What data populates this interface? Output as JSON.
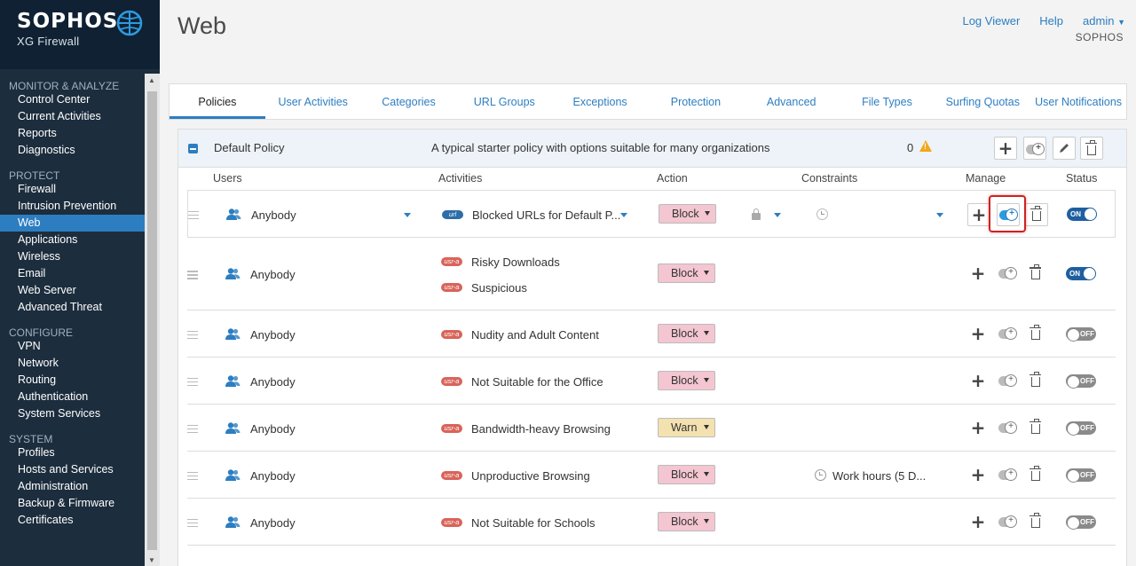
{
  "brand": {
    "name": "SOPHOS",
    "product": "XG Firewall"
  },
  "header": {
    "title": "Web",
    "links": [
      "Log Viewer",
      "Help",
      "admin"
    ],
    "company": "SOPHOS"
  },
  "sidebar": {
    "sections": [
      {
        "heading": "MONITOR & ANALYZE",
        "items": [
          "Control Center",
          "Current Activities",
          "Reports",
          "Diagnostics"
        ]
      },
      {
        "heading": "PROTECT",
        "items": [
          "Firewall",
          "Intrusion Prevention",
          "Web",
          "Applications",
          "Wireless",
          "Email",
          "Web Server",
          "Advanced Threat"
        ]
      },
      {
        "heading": "CONFIGURE",
        "items": [
          "VPN",
          "Network",
          "Routing",
          "Authentication",
          "System Services"
        ]
      },
      {
        "heading": "SYSTEM",
        "items": [
          "Profiles",
          "Hosts and Services",
          "Administration",
          "Backup & Firmware",
          "Certificates"
        ]
      }
    ],
    "active": "Web"
  },
  "tabs": [
    "Policies",
    "User Activities",
    "Categories",
    "URL Groups",
    "Exceptions",
    "Protection",
    "Advanced",
    "File Types",
    "Surfing Quotas",
    "User Notifications"
  ],
  "active_tab": "Policies",
  "policy": {
    "name": "Default Policy",
    "description": "A typical starter policy with options suitable for many organizations",
    "count": "0"
  },
  "columns": {
    "users": "Users",
    "activities": "Activities",
    "action": "Action",
    "constraints": "Constraints",
    "manage": "Manage",
    "status": "Status"
  },
  "rules": [
    {
      "user": "Anybody",
      "activities": [
        {
          "badge": "url",
          "label": "Blocked URLs for Default P..."
        }
      ],
      "action": "Block",
      "constraint": "",
      "status": "ON"
    },
    {
      "user": "Anybody",
      "activities": [
        {
          "badge": "usr-a",
          "label": "Risky Downloads"
        },
        {
          "badge": "usr-a",
          "label": "Suspicious"
        }
      ],
      "action": "Block",
      "constraint": "",
      "status": "ON"
    },
    {
      "user": "Anybody",
      "activities": [
        {
          "badge": "usr-a",
          "label": "Nudity and Adult Content"
        }
      ],
      "action": "Block",
      "constraint": "",
      "status": "OFF"
    },
    {
      "user": "Anybody",
      "activities": [
        {
          "badge": "usr-a",
          "label": "Not Suitable for the Office"
        }
      ],
      "action": "Block",
      "constraint": "",
      "status": "OFF"
    },
    {
      "user": "Anybody",
      "activities": [
        {
          "badge": "usr-a",
          "label": "Bandwidth-heavy Browsing"
        }
      ],
      "action": "Warn",
      "constraint": "",
      "status": "OFF"
    },
    {
      "user": "Anybody",
      "activities": [
        {
          "badge": "usr-a",
          "label": "Unproductive Browsing"
        }
      ],
      "action": "Block",
      "constraint": "Work hours (5 D...",
      "status": "OFF"
    },
    {
      "user": "Anybody",
      "activities": [
        {
          "badge": "usr-a",
          "label": "Not Suitable for Schools"
        }
      ],
      "action": "Block",
      "constraint": "",
      "status": "OFF"
    }
  ],
  "colors": {
    "accent": "#2d7ec1",
    "sidebar": "#1c2d3d",
    "block": "#f3c6d1",
    "warn": "#f4e1b0",
    "highlight": "#cc2222"
  }
}
